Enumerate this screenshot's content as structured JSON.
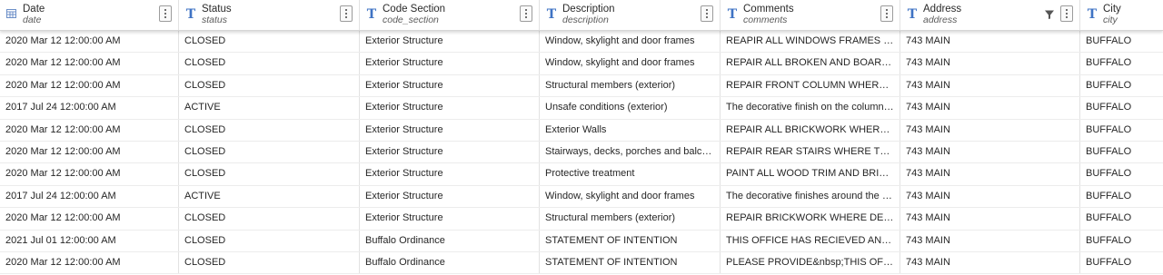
{
  "columns": [
    {
      "title": "Date",
      "field": "date",
      "icon": "calendar-icon"
    },
    {
      "title": "Status",
      "field": "status",
      "icon": "text-type-icon"
    },
    {
      "title": "Code Section",
      "field": "code_section",
      "icon": "text-type-icon"
    },
    {
      "title": "Description",
      "field": "description",
      "icon": "text-type-icon"
    },
    {
      "title": "Comments",
      "field": "comments",
      "icon": "text-type-icon"
    },
    {
      "title": "Address",
      "field": "address",
      "icon": "text-type-icon",
      "filtered": true
    },
    {
      "title": "City",
      "field": "city",
      "icon": "text-type-icon"
    }
  ],
  "rows": [
    {
      "date": "2020 Mar 12 12:00:00 AM",
      "status": "CLOSED",
      "code_section": "Exterior Structure",
      "description": "Window, skylight and door frames",
      "comments": "REAPIR ALL WINDOWS FRAMES FRONT...",
      "address": "743 MAIN",
      "city": "BUFFALO"
    },
    {
      "date": "2020 Mar 12 12:00:00 AM",
      "status": "CLOSED",
      "code_section": "Exterior Structure",
      "description": "Window, skylight and door frames",
      "comments": "REPAIR ALL BROKEN AND BOARDED ...",
      "address": "743 MAIN",
      "city": "BUFFALO"
    },
    {
      "date": "2020 Mar 12 12:00:00 AM",
      "status": "CLOSED",
      "code_section": "Exterior Structure",
      "description": "Structural members (exterior)",
      "comments": "REPAIR FRONT COLUMN WHERE DETE...",
      "address": "743 MAIN",
      "city": "BUFFALO"
    },
    {
      "date": "2017 Jul 24 12:00:00 AM",
      "status": "ACTIVE",
      "code_section": "Exterior Structure",
      "description": "Unsafe conditions (exterior)",
      "comments": "The decorative finish on the columns in...",
      "address": "743 MAIN",
      "city": "BUFFALO"
    },
    {
      "date": "2020 Mar 12 12:00:00 AM",
      "status": "CLOSED",
      "code_section": "Exterior Structure",
      "description": "Exterior Walls",
      "comments": "REPAIR ALL BRICKWORK WHERE DETE...",
      "address": "743 MAIN",
      "city": "BUFFALO"
    },
    {
      "date": "2020 Mar 12 12:00:00 AM",
      "status": "CLOSED",
      "code_section": "Exterior Structure",
      "description": "Stairways, decks, porches and balconies",
      "comments": "REPAIR REAR STAIRS WHERE TREAD I...",
      "address": "743 MAIN",
      "city": "BUFFALO"
    },
    {
      "date": "2020 Mar 12 12:00:00 AM",
      "status": "CLOSED",
      "code_section": "Exterior Structure",
      "description": "Protective treatment",
      "comments": "PAINT ALL WOOD TRIM AND BRICKWO...",
      "address": "743 MAIN",
      "city": "BUFFALO"
    },
    {
      "date": "2017 Jul 24 12:00:00 AM",
      "status": "ACTIVE",
      "code_section": "Exterior Structure",
      "description": "Window, skylight and door frames",
      "comments": "The decorative finishes around the win...",
      "address": "743 MAIN",
      "city": "BUFFALO"
    },
    {
      "date": "2020 Mar 12 12:00:00 AM",
      "status": "CLOSED",
      "code_section": "Exterior Structure",
      "description": "Structural members (exterior)",
      "comments": "REPAIR BRICKWORK WHERE DETERIO...",
      "address": "743 MAIN",
      "city": "BUFFALO"
    },
    {
      "date": "2021 Jul 01 12:00:00 AM",
      "status": "CLOSED",
      "code_section": "Buffalo Ordinance",
      "description": "STATEMENT OF INTENTION",
      "comments": "THIS OFFICE HAS RECIEVED ANOTHE...",
      "address": "743 MAIN",
      "city": "BUFFALO"
    },
    {
      "date": "2020 Mar 12 12:00:00 AM",
      "status": "CLOSED",
      "code_section": "Buffalo Ordinance",
      "description": "STATEMENT OF INTENTION",
      "comments": "PLEASE PROVIDE&nbsp;THIS OFFICE ...",
      "address": "743 MAIN",
      "city": "BUFFALO"
    }
  ],
  "colors": {
    "icon_accent": "#3f73c4",
    "border": "#e2e2e2"
  }
}
